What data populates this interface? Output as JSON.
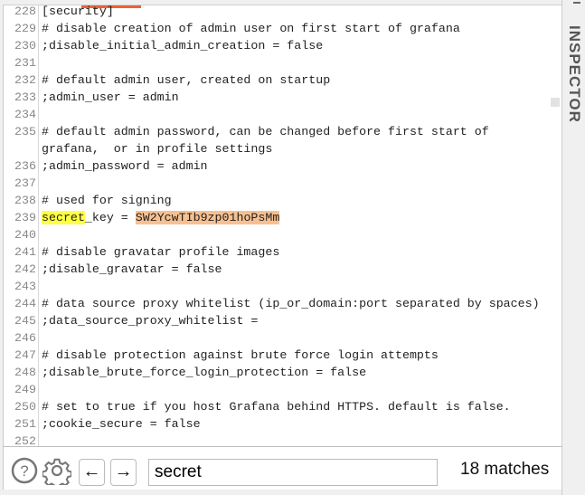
{
  "editor": {
    "lines": [
      {
        "num": "228",
        "text": "[security]"
      },
      {
        "num": "229",
        "text": "# disable creation of admin user on first start of grafana"
      },
      {
        "num": "230",
        "text": ";disable_initial_admin_creation = false"
      },
      {
        "num": "231",
        "text": ""
      },
      {
        "num": "232",
        "text": "# default admin user, created on startup"
      },
      {
        "num": "233",
        "text": ";admin_user = admin"
      },
      {
        "num": "234",
        "text": ""
      },
      {
        "num": "235",
        "text": "# default admin password, can be changed before first start of"
      },
      {
        "num": "",
        "text": "grafana,  or in profile settings"
      },
      {
        "num": "236",
        "text": ";admin_password = admin"
      },
      {
        "num": "237",
        "text": ""
      },
      {
        "num": "238",
        "text": "# used for signing"
      },
      {
        "num": "239",
        "text": ""
      },
      {
        "num": "240",
        "text": ""
      },
      {
        "num": "241",
        "text": "# disable gravatar profile images"
      },
      {
        "num": "242",
        "text": ";disable_gravatar = false"
      },
      {
        "num": "243",
        "text": ""
      },
      {
        "num": "244",
        "text": "# data source proxy whitelist (ip_or_domain:port separated by spaces)"
      },
      {
        "num": "245",
        "text": ";data_source_proxy_whitelist ="
      },
      {
        "num": "246",
        "text": ""
      },
      {
        "num": "247",
        "text": "# disable protection against brute force login attempts"
      },
      {
        "num": "248",
        "text": ";disable_brute_force_login_protection = false"
      },
      {
        "num": "249",
        "text": ""
      },
      {
        "num": "250",
        "text": "# set to true if you host Grafana behind HTTPS. default is false."
      },
      {
        "num": "251",
        "text": ";cookie_secure = false"
      },
      {
        "num": "252",
        "text": ""
      }
    ],
    "match_line": {
      "match": "secret",
      "rest": "_key = ",
      "value": "SW2YcwTIb9zp01hoPsMm"
    },
    "colors": {
      "match": "#ffff44",
      "value": "#f8c090",
      "tab_accent": "#f06030"
    }
  },
  "findbar": {
    "help_icon": "question-circle-icon",
    "settings_icon": "gear-icon",
    "prev_label": "←",
    "next_label": "→",
    "query": "secret",
    "matches": "18 matches"
  },
  "inspector": {
    "label": "INSPECTOR"
  }
}
